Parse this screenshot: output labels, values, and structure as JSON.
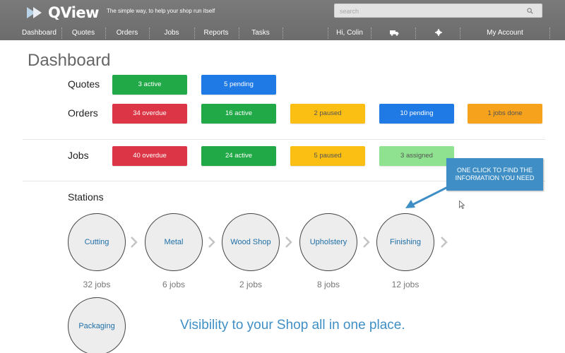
{
  "app": {
    "name": "QView",
    "tagline": "The simple way, to help your shop run itself"
  },
  "search": {
    "placeholder": "search"
  },
  "nav": {
    "items": [
      "Dashboard",
      "Quotes",
      "Orders",
      "Jobs",
      "Reports",
      "Tasks"
    ],
    "greeting": "Hi, Colin",
    "truck_icon": "truck-icon",
    "settings_icon": "gear-icon",
    "account": "My Account"
  },
  "page": {
    "title": "Dashboard"
  },
  "quotes": {
    "label": "Quotes",
    "pills": [
      {
        "text": "3 active",
        "color": "#21a847"
      },
      {
        "text": "5 pending",
        "color": "#1f7ae6"
      }
    ]
  },
  "orders": {
    "label": "Orders",
    "pills": [
      {
        "text": "34 overdue",
        "color": "#dc3545"
      },
      {
        "text": "16 active",
        "color": "#21a847"
      },
      {
        "text": "2 paused",
        "color": "#fbbf14"
      },
      {
        "text": "10 pending",
        "color": "#1f7ae6"
      },
      {
        "text": "1 jobs done",
        "color": "#f7a21c"
      }
    ]
  },
  "jobs": {
    "label": "Jobs",
    "pills": [
      {
        "text": "40 overdue",
        "color": "#dc3545"
      },
      {
        "text": "24 active",
        "color": "#21a847"
      },
      {
        "text": "5 paused",
        "color": "#fbbf14"
      },
      {
        "text": "3 assigned",
        "color": "#8fe28f"
      }
    ]
  },
  "stations": {
    "label": "Stations",
    "items": [
      {
        "name": "Cutting",
        "jobs": "32 jobs"
      },
      {
        "name": "Metal",
        "jobs": "6 jobs"
      },
      {
        "name": "Wood Shop",
        "jobs": "2 jobs"
      },
      {
        "name": "Upholstery",
        "jobs": "8 jobs"
      },
      {
        "name": "Finishing",
        "jobs": "12 jobs"
      },
      {
        "name": "Packaging",
        "jobs": ""
      }
    ]
  },
  "callout": {
    "line1": "ONE CLICK TO FIND THE",
    "line2": "INFORMATION YOU NEED"
  },
  "caption": "Visibility to your Shop all in one place."
}
